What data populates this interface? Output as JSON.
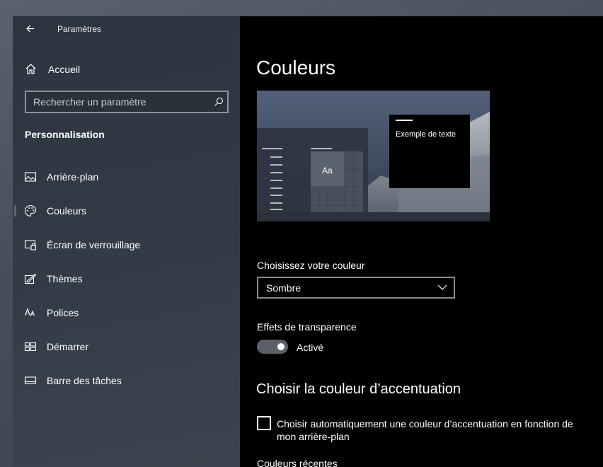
{
  "app": {
    "title": "Paramètres"
  },
  "sidebar": {
    "home_label": "Accueil",
    "search_placeholder": "Rechercher un paramètre",
    "section_title": "Personnalisation",
    "items": [
      {
        "label": "Arrière-plan",
        "icon": "image-icon"
      },
      {
        "label": "Couleurs",
        "icon": "palette-icon",
        "selected": true
      },
      {
        "label": "Écran de verrouillage",
        "icon": "lock-screen-icon"
      },
      {
        "label": "Thèmes",
        "icon": "themes-icon"
      },
      {
        "label": "Polices",
        "icon": "fonts-icon"
      },
      {
        "label": "Démarrer",
        "icon": "start-icon"
      },
      {
        "label": "Barre des tâches",
        "icon": "taskbar-icon"
      }
    ]
  },
  "main": {
    "title": "Couleurs",
    "preview": {
      "sample_text": "Exemple de texte",
      "tile_text": "Aa"
    },
    "color_mode": {
      "label": "Choisissez votre couleur",
      "value": "Sombre"
    },
    "transparency": {
      "label": "Effets de transparence",
      "state_label": "Activé",
      "on": true
    },
    "accent": {
      "heading": "Choisir la couleur d’accentuation",
      "auto_label": "Choisir automatiquement une couleur d’accentuation en fonction de mon arrière-plan",
      "auto_checked": false,
      "recent_label": "Couleurs récentes"
    }
  },
  "colors": {
    "sidebar_bg": "#343b47",
    "main_bg": "#000000",
    "toggle_track": "#5a5f69"
  }
}
